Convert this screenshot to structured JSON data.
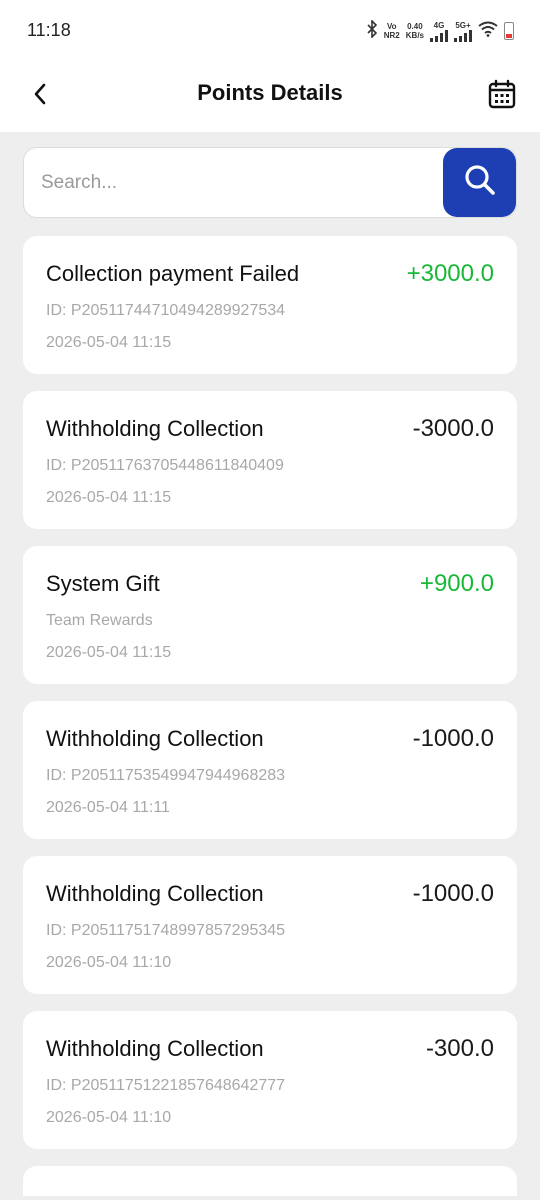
{
  "status_bar": {
    "time": "11:18",
    "net_top": "Vo",
    "net_bottom": "NR2",
    "speed_value": "0.40",
    "speed_unit": "KB/s",
    "sig1_label": "4G",
    "sig2_label": "5G+"
  },
  "header": {
    "title": "Points Details",
    "back_icon": "chevron-left-icon",
    "calendar_icon": "calendar-icon"
  },
  "search": {
    "placeholder": "Search...",
    "value": "",
    "button_icon": "search-icon"
  },
  "colors": {
    "accent": "#1d3fb3",
    "positive": "#19b838",
    "negative": "#1a1a1a"
  },
  "records": [
    {
      "title": "Collection payment Failed",
      "amount": "+3000.0",
      "positive": true,
      "sub": "ID: P20511744710494289927534",
      "time": "2026-05-04 11:15"
    },
    {
      "title": "Withholding Collection",
      "amount": "-3000.0",
      "positive": false,
      "sub": "ID: P20511763705448611840409",
      "time": "2026-05-04 11:15"
    },
    {
      "title": "System Gift",
      "amount": "+900.0",
      "positive": true,
      "sub": "Team Rewards",
      "time": "2026-05-04 11:15"
    },
    {
      "title": "Withholding Collection",
      "amount": "-1000.0",
      "positive": false,
      "sub": "ID: P20511753549947944968283",
      "time": "2026-05-04 11:11"
    },
    {
      "title": "Withholding Collection",
      "amount": "-1000.0",
      "positive": false,
      "sub": "ID: P20511751748997857295345",
      "time": "2026-05-04 11:10"
    },
    {
      "title": "Withholding Collection",
      "amount": "-300.0",
      "positive": false,
      "sub": "ID: P20511751221857648642777",
      "time": "2026-05-04 11:10"
    }
  ]
}
